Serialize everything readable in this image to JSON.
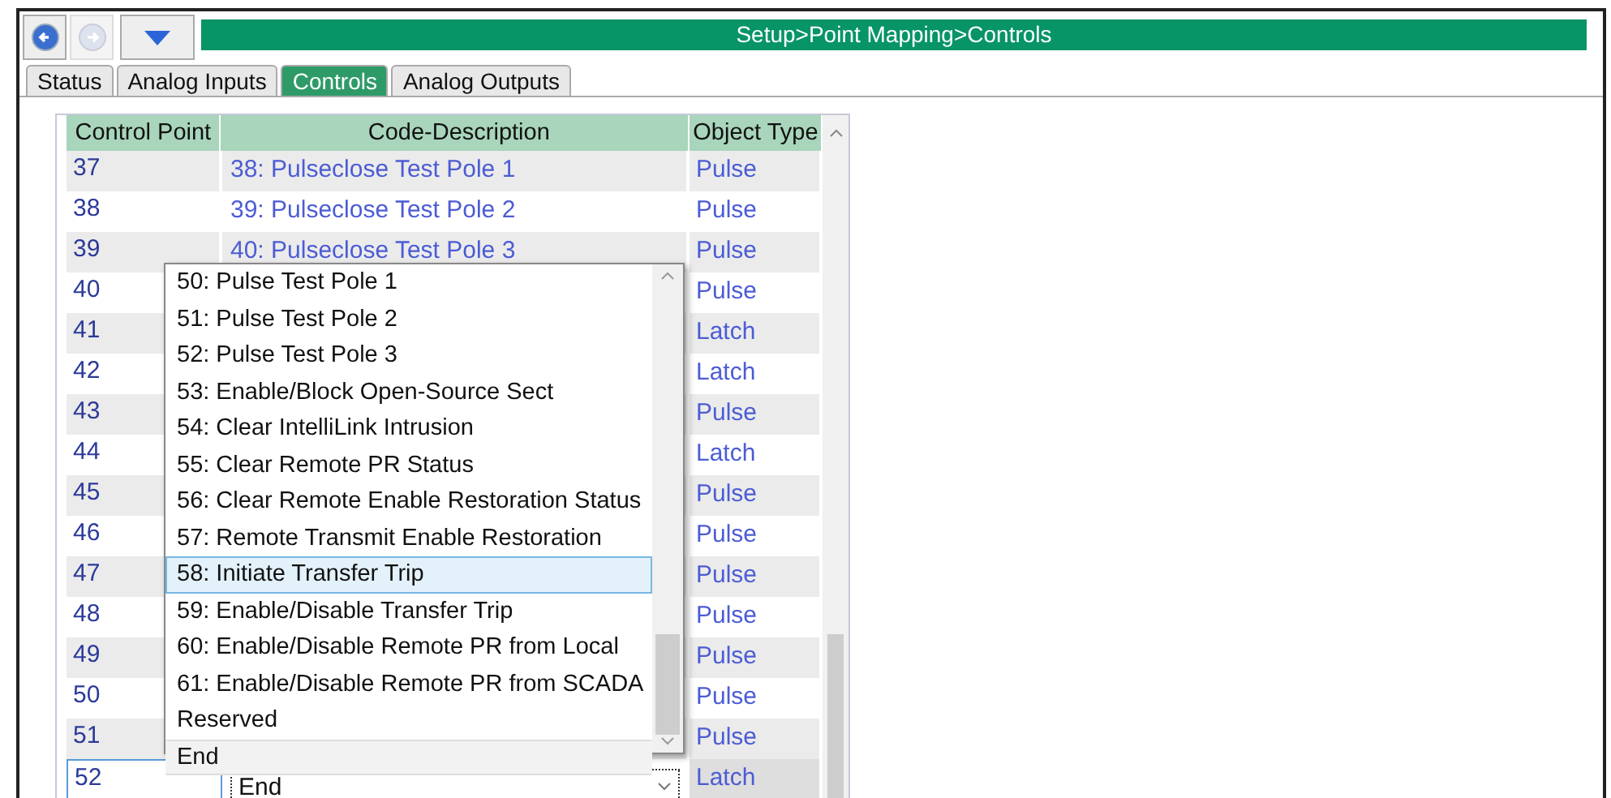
{
  "breadcrumb": "Setup>Point Mapping>Controls",
  "nav": {
    "back_disabled": false,
    "forward_disabled": true
  },
  "tabs": [
    {
      "label": "Status",
      "selected": false
    },
    {
      "label": "Analog Inputs",
      "selected": false
    },
    {
      "label": "Controls",
      "selected": true
    },
    {
      "label": "Analog Outputs",
      "selected": false
    }
  ],
  "table": {
    "columns": [
      "Control Point",
      "Code-Description",
      "Object Type"
    ],
    "rows": [
      {
        "point": "37",
        "code": "38: Pulseclose Test Pole 1",
        "type": "Pulse",
        "selected": false
      },
      {
        "point": "38",
        "code": "39: Pulseclose Test Pole 2",
        "type": "Pulse",
        "selected": false
      },
      {
        "point": "39",
        "code": "40: Pulseclose Test Pole 3",
        "type": "Pulse",
        "selected": false
      },
      {
        "point": "40",
        "type": "Pulse",
        "selected": false
      },
      {
        "point": "41",
        "type": "Latch",
        "selected": false
      },
      {
        "point": "42",
        "type": "Latch",
        "selected": false
      },
      {
        "point": "43",
        "type": "Pulse",
        "selected": false
      },
      {
        "point": "44",
        "type": "Latch",
        "selected": false
      },
      {
        "point": "45",
        "type": "Pulse",
        "selected": false
      },
      {
        "point": "46",
        "type": "Pulse",
        "selected": false
      },
      {
        "point": "47",
        "type": "Pulse",
        "selected": false
      },
      {
        "point": "48",
        "type": "Pulse",
        "selected": false
      },
      {
        "point": "49",
        "type": "Pulse",
        "selected": false
      },
      {
        "point": "50",
        "type": "Pulse",
        "selected": false
      },
      {
        "point": "51",
        "type": "Pulse",
        "selected": false
      },
      {
        "point": "52",
        "code": "End",
        "type": "Latch",
        "selected": true
      }
    ]
  },
  "dropdown": {
    "items": [
      {
        "label": "50: Pulse Test Pole 1",
        "selected": false
      },
      {
        "label": "51: Pulse Test Pole 2",
        "selected": false
      },
      {
        "label": "52: Pulse Test Pole 3",
        "selected": false
      },
      {
        "label": "53: Enable/Block Open-Source Sect",
        "selected": false
      },
      {
        "label": "54: Clear IntelliLink Intrusion",
        "selected": false
      },
      {
        "label": "55: Clear Remote PR Status",
        "selected": false
      },
      {
        "label": "56: Clear Remote Enable Restoration Status",
        "selected": false
      },
      {
        "label": "57: Remote Transmit Enable Restoration",
        "selected": false
      },
      {
        "label": "58: Initiate Transfer Trip",
        "selected": true
      },
      {
        "label": "59: Enable/Disable Transfer Trip",
        "selected": false
      },
      {
        "label": "60: Enable/Disable Remote PR from Local",
        "selected": false
      },
      {
        "label": "61: Enable/Disable Remote PR from SCADA",
        "selected": false
      },
      {
        "label": "Reserved",
        "selected": false
      },
      {
        "label": "End",
        "selected": false
      }
    ]
  }
}
